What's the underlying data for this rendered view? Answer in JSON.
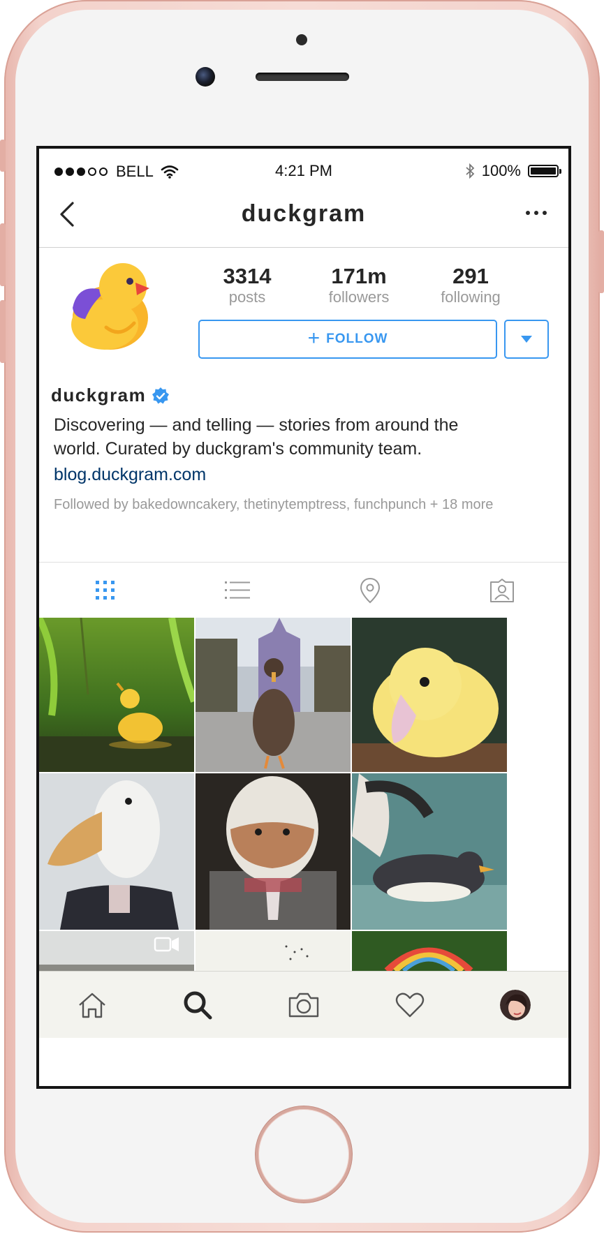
{
  "status_bar": {
    "carrier": "BELL",
    "time": "4:21 PM",
    "battery": "100%"
  },
  "header": {
    "title": "duckgram"
  },
  "profile": {
    "stats": [
      {
        "value": "3314",
        "label": "posts"
      },
      {
        "value": "171m",
        "label": "followers"
      },
      {
        "value": "291",
        "label": "following"
      }
    ],
    "follow_label": "FOLLOW",
    "name": "duckgram",
    "bio_line1": "Discovering — and telling — stories from around the",
    "bio_line2": "world. Curated by duckgram's community team.",
    "link": "blog.duckgram.com",
    "followed_by": "Followed by bakedowncakery, thetinytemptress, funchpunch + 18 more"
  },
  "tabs": [
    {
      "icon": "grid-icon",
      "active": true
    },
    {
      "icon": "list-icon",
      "active": false
    },
    {
      "icon": "location-pin-icon",
      "active": false
    },
    {
      "icon": "tagged-user-icon",
      "active": false
    }
  ],
  "grid_posts": [
    {
      "subject": "duckling-in-water"
    },
    {
      "subject": "duck-in-front-of-castle"
    },
    {
      "subject": "yellow-duckling-closeup"
    },
    {
      "subject": "goose-head-in-suit"
    },
    {
      "subject": "howard-the-duck"
    },
    {
      "subject": "steamer-duck-splashing"
    },
    {
      "subject": "landscape-video"
    },
    {
      "subject": "birds-in-sky"
    },
    {
      "subject": "flower-wreath"
    }
  ],
  "bottom_tabs": [
    "home-icon",
    "search-icon",
    "camera-icon",
    "heart-icon",
    "profile-avatar"
  ],
  "colors": {
    "accent": "#3897f0",
    "link": "#003569",
    "secondary_text": "#999999",
    "duck_yellow": "#f9c22e",
    "duck_purple": "#7b4fd6"
  }
}
